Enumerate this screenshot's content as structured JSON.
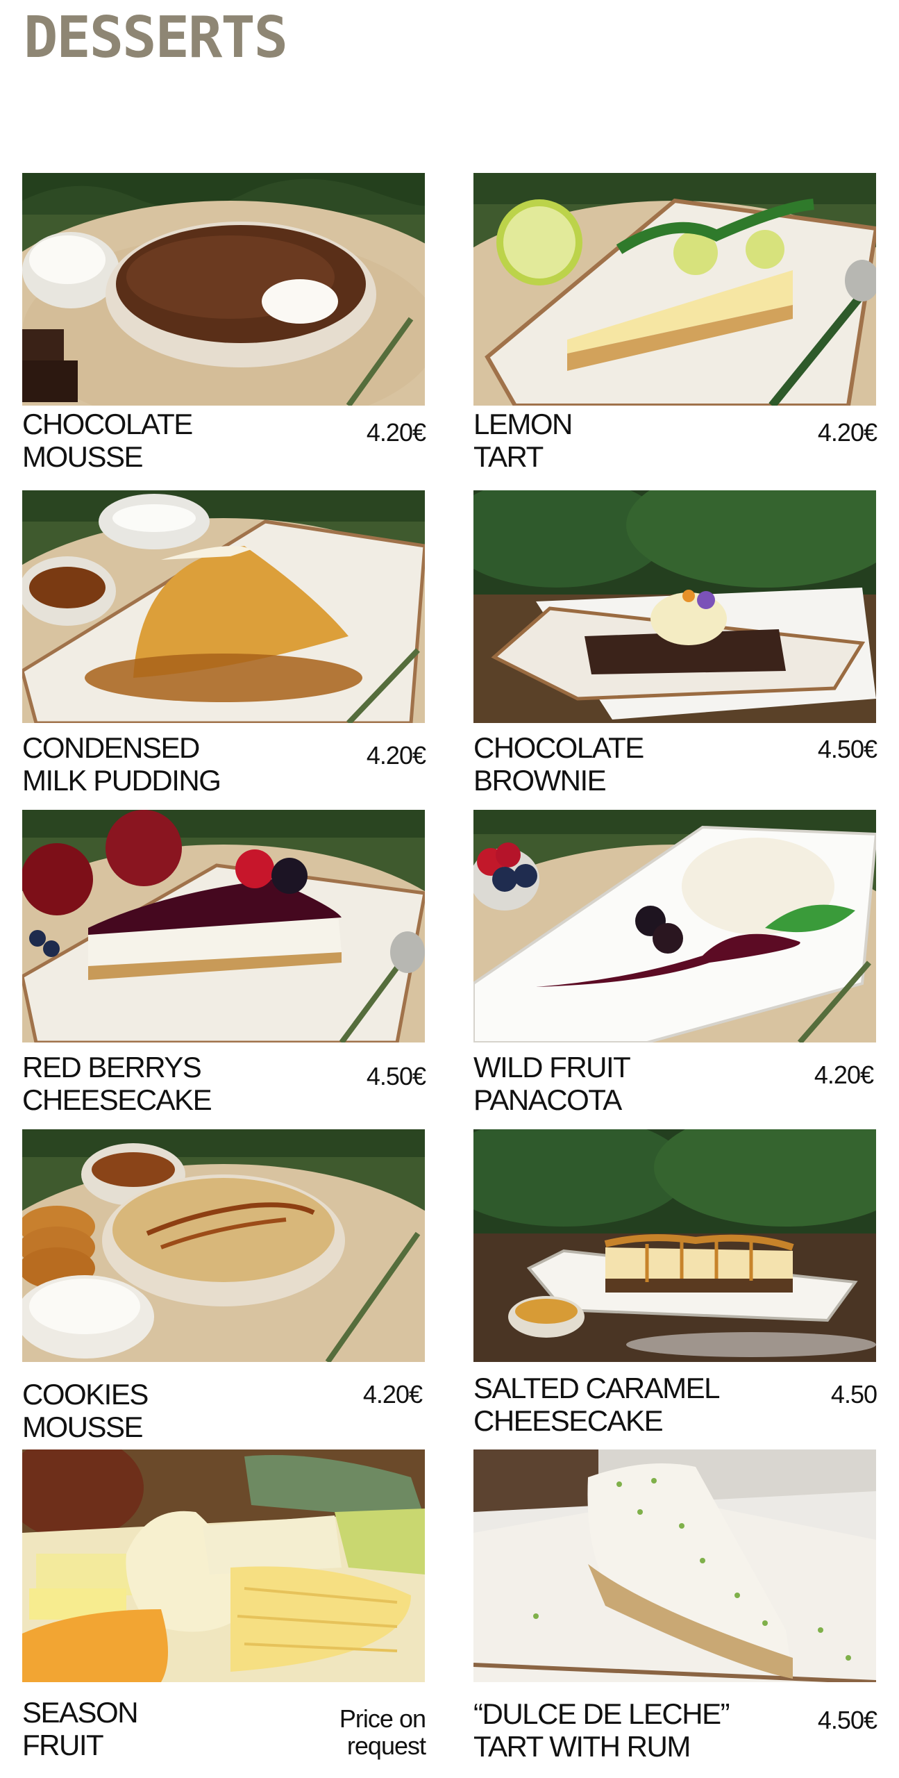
{
  "page": {
    "title": "DESSERTS"
  },
  "items": [
    {
      "name_line1": "CHOCOLATE",
      "name_line2": "MOUSSE",
      "price": "4.20€"
    },
    {
      "name_line1": "LEMON",
      "name_line2": "TART",
      "price": "4.20€"
    },
    {
      "name_line1": "CONDENSED",
      "name_line2": "MILK PUDDING",
      "price": "4.20€"
    },
    {
      "name_line1": "CHOCOLATE",
      "name_line2": "BROWNIE",
      "price": "4.50€"
    },
    {
      "name_line1": "RED BERRYS",
      "name_line2": "CHEESECAKE",
      "price": "4.50€"
    },
    {
      "name_line1": "WILD FRUIT",
      "name_line2": "PANACOTA",
      "price": "4.20€"
    },
    {
      "name_line1": "COOKIES",
      "name_line2": "MOUSSE",
      "price": "4.20€"
    },
    {
      "name_line1": "SALTED CARAMEL",
      "name_line2": "CHEESECAKE",
      "price": "4.50"
    },
    {
      "name_line1": "SEASON",
      "name_line2": "FRUIT",
      "price_line1": "Price on",
      "price_line2": "request"
    },
    {
      "name_line1": "“DULCE DE LECHE”",
      "name_line2": "TART WITH RUM",
      "price": "4.50€"
    }
  ],
  "colors": {
    "title": "#8e8674",
    "text": "#111111",
    "placemat": "#d8c3a0",
    "plate": "#f1ede4",
    "foliage": "#2f5a2c"
  }
}
